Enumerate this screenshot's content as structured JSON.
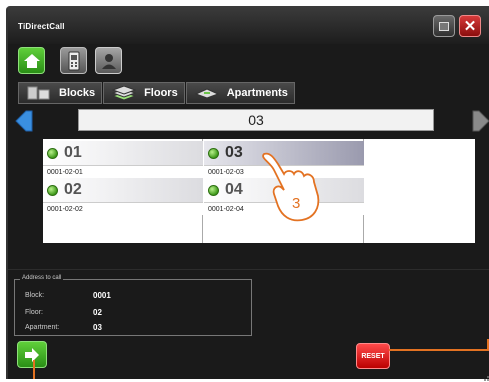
{
  "window": {
    "title": "TiDirectCall"
  },
  "toolbar": {
    "home_icon": "home-icon",
    "phone_icon": "intercom-icon",
    "user_icon": "user-icon"
  },
  "tabs": [
    {
      "label": "Blocks",
      "icon": "blocks-icon"
    },
    {
      "label": "Floors",
      "icon": "floors-icon"
    },
    {
      "label": "Apartments",
      "icon": "apartments-icon"
    }
  ],
  "floor": {
    "value": "03"
  },
  "apartments": [
    {
      "number": "01",
      "code": "0001-02-01"
    },
    {
      "number": "03",
      "code": "0001-02-03",
      "selected": true
    },
    {
      "number": "02",
      "code": "0001-02-02"
    },
    {
      "number": "04",
      "code": "0001-02-04"
    }
  ],
  "address": {
    "legend": "Address to call",
    "block_label": "Block:",
    "block_value": "0001",
    "floor_label": "Floor:",
    "floor_value": "02",
    "apartment_label": "Apartment:",
    "apartment_value": "03"
  },
  "buttons": {
    "reset": "RESET"
  },
  "callout": {
    "number": "3"
  },
  "colors": {
    "accent": "#e37222",
    "green": "#3fae1f",
    "red": "#cc1111"
  }
}
